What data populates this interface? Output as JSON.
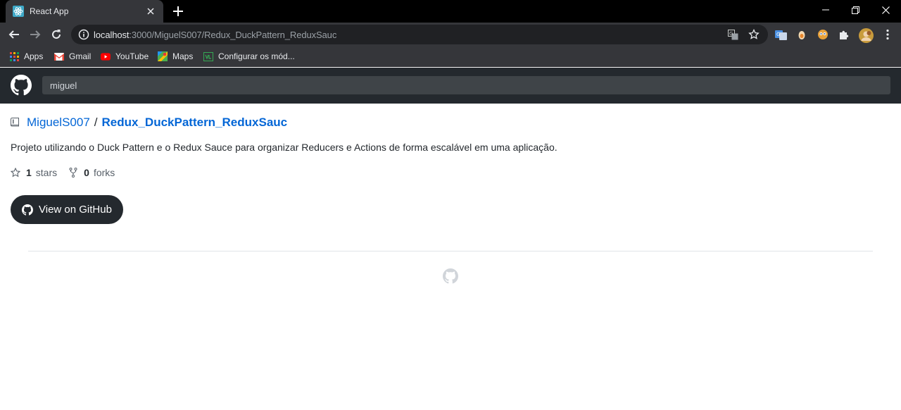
{
  "browser": {
    "tab_title": "React App",
    "url_host": "localhost",
    "url_rest": ":3000/MiguelS007/Redux_DuckPattern_ReduxSauc",
    "window_controls": [
      "minimize-icon",
      "restore-icon",
      "close-icon"
    ],
    "bookmarks": [
      {
        "label": "Apps",
        "icon": "apps-grid-icon"
      },
      {
        "label": "Gmail",
        "icon": "gmail-icon"
      },
      {
        "label": "YouTube",
        "icon": "youtube-icon"
      },
      {
        "label": "Maps",
        "icon": "maps-icon"
      },
      {
        "label": "Configurar os mód...",
        "icon": "classroom-icon"
      }
    ]
  },
  "header": {
    "search_value": "miguel"
  },
  "repo": {
    "owner": "MiguelS007",
    "separator": "/",
    "name": "Redux_DuckPattern_ReduxSauc",
    "description": "Projeto utilizando o Duck Pattern e o Redux Sauce para organizar Reducers e Actions de forma escalável em uma aplicação.",
    "stars_count": "1",
    "stars_label": "stars",
    "forks_count": "0",
    "forks_label": "forks",
    "button_label": "View on GitHub"
  },
  "colors": {
    "header_bg": "#24292e",
    "link": "#0366d6",
    "button_bg": "#24292e"
  }
}
